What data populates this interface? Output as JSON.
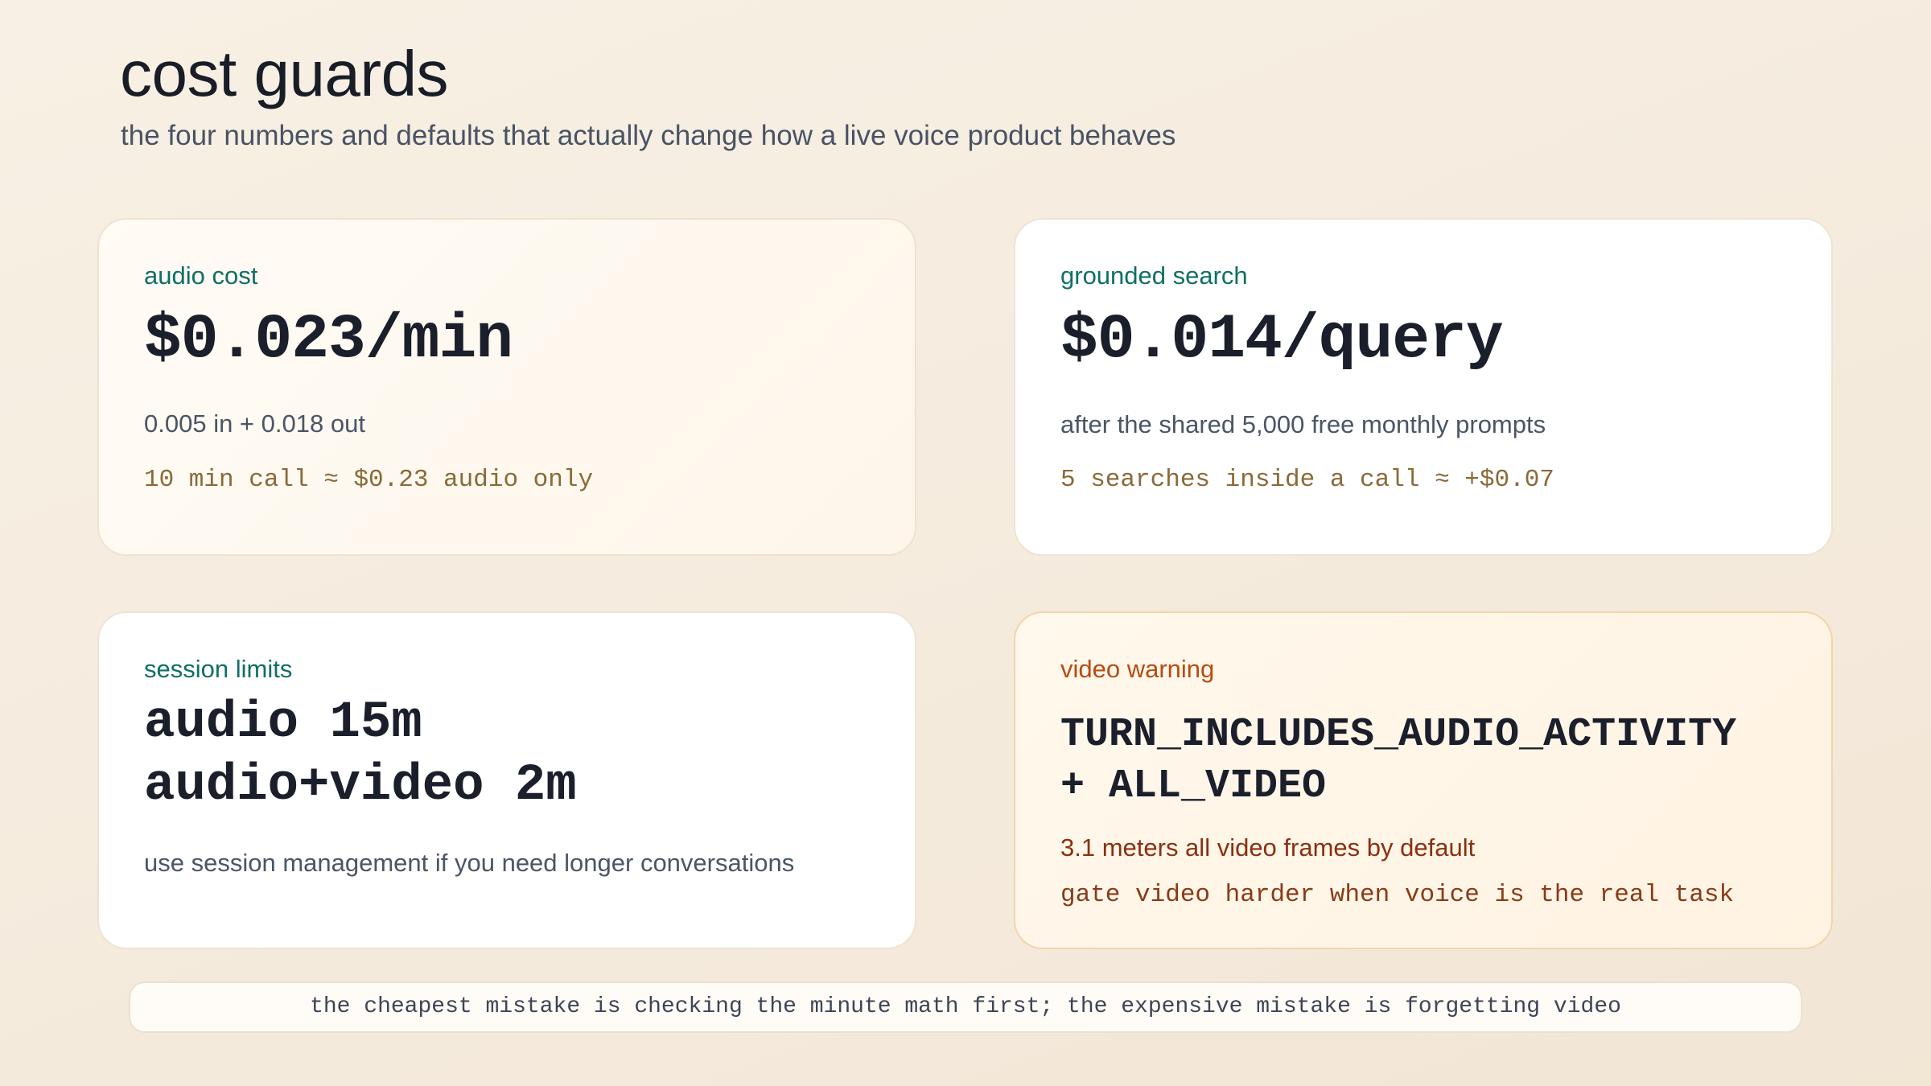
{
  "header": {
    "title": "cost guards",
    "subtitle": "the four numbers and defaults that actually change how a live voice product behaves"
  },
  "cards": {
    "audio_cost": {
      "kicker": "audio cost",
      "headline": "$0.023/min",
      "detail": "0.005 in + 0.018 out",
      "example": "10 min call ≈ $0.23 audio only"
    },
    "grounded_search": {
      "kicker": "grounded search",
      "headline": "$0.014/query",
      "detail": "after the shared 5,000 free monthly prompts",
      "example": "5 searches inside a call ≈ +$0.07"
    },
    "session_limits": {
      "kicker": "session limits",
      "headline_line1": "audio 15m",
      "headline_line2": "audio+video 2m",
      "detail": "use session management if you need longer conversations"
    },
    "video_warning": {
      "kicker": "video warning",
      "headline_line1": "TURN_INCLUDES_AUDIO_ACTIVITY",
      "headline_line2": "+ ALL_VIDEO",
      "detail": "3.1 meters all video frames by default",
      "example": "gate video harder when voice is the real task"
    }
  },
  "footer": {
    "text": "the cheapest mistake is checking the minute math first; the expensive mistake is forgetting video"
  },
  "colors": {
    "accent_teal": "#0f6f66",
    "warning_orange": "#b94a12",
    "mono_brown": "#8a6a37",
    "text_dark": "#1a1f2b"
  }
}
